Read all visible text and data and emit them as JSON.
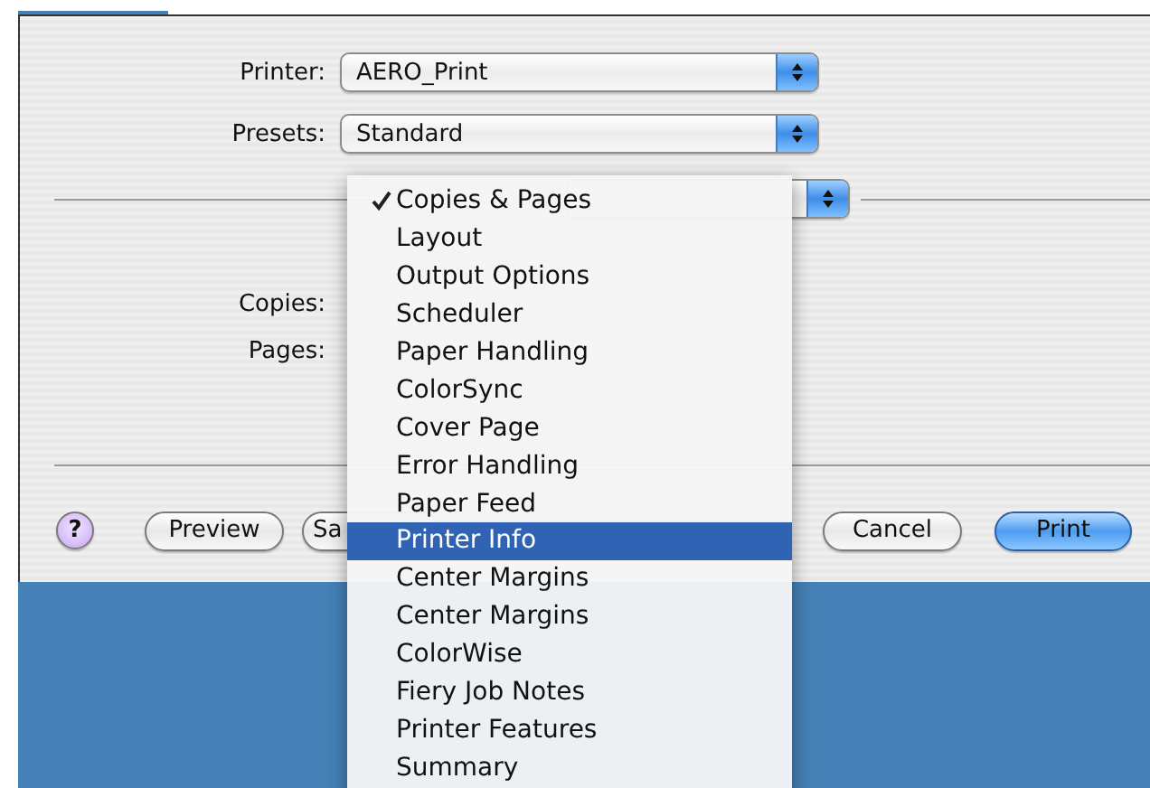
{
  "dialog": {
    "printer": {
      "label": "Printer:",
      "value": "AERO_Print"
    },
    "presets": {
      "label": "Presets:",
      "value": "Standard"
    },
    "copies_label": "Copies:",
    "pages_label": "Pages:",
    "buttons": [
      {
        "kind": "help",
        "label": "?"
      },
      {
        "kind": "normal",
        "label": "Preview"
      },
      {
        "kind": "normal",
        "label": "Sa"
      },
      {
        "kind": "normal",
        "label": "Cancel"
      },
      {
        "kind": "default",
        "label": "Print"
      }
    ]
  },
  "menu": {
    "items": [
      {
        "label": "Copies & Pages",
        "checked": true,
        "selected": false
      },
      {
        "label": "Layout",
        "checked": false,
        "selected": false
      },
      {
        "label": "Output Options",
        "checked": false,
        "selected": false
      },
      {
        "label": "Scheduler",
        "checked": false,
        "selected": false
      },
      {
        "label": "Paper Handling",
        "checked": false,
        "selected": false
      },
      {
        "label": "ColorSync",
        "checked": false,
        "selected": false
      },
      {
        "label": "Cover Page",
        "checked": false,
        "selected": false
      },
      {
        "label": "Error Handling",
        "checked": false,
        "selected": false
      },
      {
        "label": "Paper Feed",
        "checked": false,
        "selected": false
      },
      {
        "label": "Printer Info",
        "checked": false,
        "selected": true
      },
      {
        "label": "Center Margins",
        "checked": false,
        "selected": false
      },
      {
        "label": "Center Margins",
        "checked": false,
        "selected": false
      },
      {
        "label": "ColorWise",
        "checked": false,
        "selected": false
      },
      {
        "label": "Fiery Job Notes",
        "checked": false,
        "selected": false
      },
      {
        "label": "Printer Features",
        "checked": false,
        "selected": false
      },
      {
        "label": "Summary",
        "checked": false,
        "selected": false
      }
    ]
  }
}
